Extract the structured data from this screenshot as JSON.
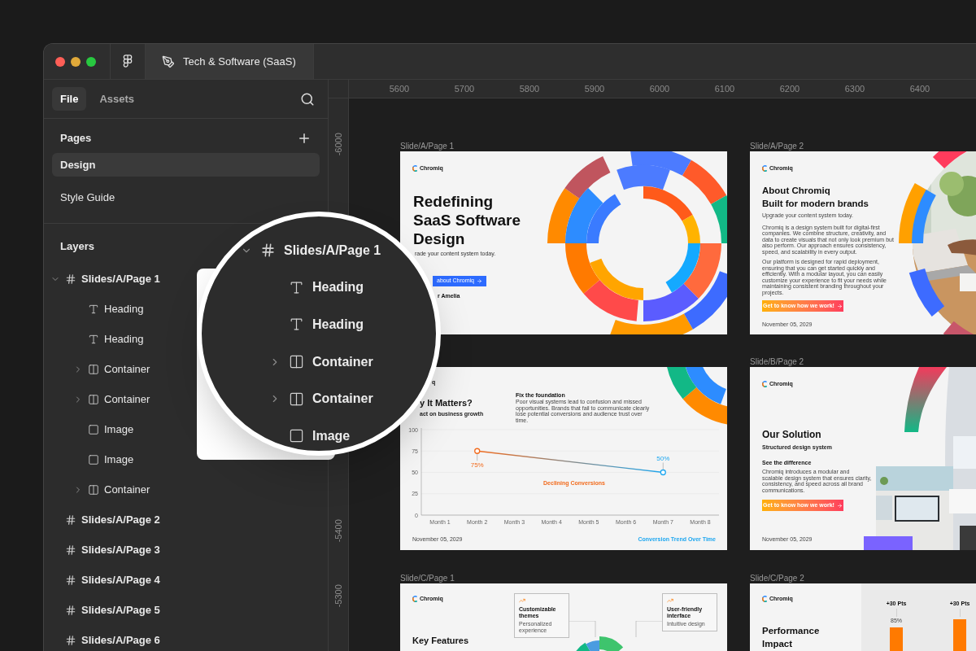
{
  "title_bar": {
    "tab_title": "Tech & Software (SaaS)"
  },
  "sidebar": {
    "tabs": [
      {
        "label": "File",
        "selected": true
      },
      {
        "label": "Assets",
        "selected": false
      }
    ],
    "pages_title": "Pages",
    "pages": [
      {
        "label": "Design",
        "selected": true
      },
      {
        "label": "Style Guide",
        "selected": false
      }
    ],
    "layers_title": "Layers",
    "layers": [
      {
        "kind": "frame",
        "label": "Slides/A/Page 1",
        "expanded": true,
        "children": [
          {
            "kind": "text",
            "label": "Heading"
          },
          {
            "kind": "text",
            "label": "Heading"
          },
          {
            "kind": "container",
            "label": "Container",
            "expanded": false
          },
          {
            "kind": "container",
            "label": "Container",
            "expanded": false
          },
          {
            "label": "Image"
          },
          {
            "label": "Image"
          },
          {
            "kind": "container",
            "label": "Container",
            "expanded": false
          }
        ]
      },
      {
        "kind": "frame",
        "label": "Slides/A/Page 2"
      },
      {
        "kind": "frame",
        "label": "Slides/A/Page 3"
      },
      {
        "kind": "frame",
        "label": "Slides/A/Page 4"
      },
      {
        "kind": "frame",
        "label": "Slides/A/Page 5"
      },
      {
        "kind": "frame",
        "label": "Slides/A/Page 6"
      }
    ]
  },
  "ruler": {
    "x_labels": [
      "5600",
      "5700",
      "5800",
      "5900",
      "6000",
      "6100",
      "6200",
      "6300",
      "6400"
    ],
    "y_labels": [
      "-6000",
      "-5400",
      "-5300"
    ]
  },
  "magnifier": {
    "layers": [
      {
        "kind": "frame",
        "label": "Slides/A/Page 1",
        "expanded": true
      },
      {
        "kind": "text",
        "label": "Heading"
      },
      {
        "kind": "text",
        "label": "Heading"
      },
      {
        "kind": "container",
        "label": "Container",
        "expanded": false
      },
      {
        "kind": "container",
        "label": "Container",
        "expanded": false
      },
      {
        "label": "Image"
      }
    ]
  },
  "slides": [
    {
      "kind": "hero",
      "label": "Slide/A/Page 1",
      "logo": "Chromiq",
      "heading": "Redefining SaaS Software Design",
      "subtitle": "rade your content system today.",
      "button": "about Chromiq",
      "author": "r Amelia"
    },
    {
      "kind": "about",
      "label": "Slide/A/Page 2",
      "logo": "Chromiq",
      "heading": "About Chromiq",
      "subheading": "Built for modern brands",
      "tagline": "Upgrade your content system today.",
      "paragraphs": [
        "Chromiq is a design system built for digital-first companies. We combine structure, creativity, and data to create visuals that not only look premium but also perform. Our approach ensures consistency, speed, and scalability in every output.",
        "Our platform is designed for rapid deployment, ensuring that you can get started quickly and efficiently. With a modular layout, you can easily customize your experience to fit your needs while maintaining consistent branding throughout your projects."
      ],
      "button": "Get to know how we work!",
      "date": "November 05, 2029"
    },
    {
      "kind": "chart",
      "logo": "q",
      "heading": "y It Matters?",
      "subtitle": "act on business growth",
      "note_title": "Fix the foundation",
      "note": "Poor visual systems lead to confusion and missed opportunities. Brands that fail to communicate clearly lose potential conversions and audience trust over time.",
      "date": "November 05, 2029",
      "chart_data": {
        "type": "line",
        "title": "Conversion Trend Over Time",
        "categories": [
          "Month 1",
          "Month 2",
          "Month 3",
          "Month 4",
          "Month 5",
          "Month 6",
          "Month 7",
          "Month 8"
        ],
        "series": [
          {
            "color": "#f26b1d",
            "marker": "circle",
            "values": [
              null,
              75,
              null,
              null,
              null,
              null,
              50,
              null
            ]
          }
        ],
        "ylim": [
          0,
          100
        ],
        "yticks": [
          0,
          25,
          50,
          75,
          100
        ],
        "grid": true,
        "annotations": [
          {
            "text": "75%",
            "x": "Month 2",
            "y": 75
          },
          {
            "text": "50%",
            "x": "Month 7",
            "y": 50
          },
          {
            "text": "Declining Conversions"
          }
        ]
      }
    },
    {
      "kind": "solution",
      "label": "Slide/B/Page 2",
      "logo": "Chromiq",
      "heading": "Our Solution",
      "subtitle": "Structured design system",
      "note_title": "See the difference",
      "note": "Chromiq introduces a modular and scalable design system that ensures clarity, consistency, and speed across all brand communications.",
      "button": "Get to know how we work!",
      "date": "November 05, 2029"
    },
    {
      "kind": "features",
      "label": "Slide/C/Page 1",
      "logo": "Chromiq",
      "heading": "Key Features",
      "cards": [
        {
          "title": "Customizable themes",
          "text": "Personalized experience"
        },
        {
          "title": "User-friendly interface",
          "text": "Intuitive design"
        }
      ]
    },
    {
      "kind": "performance",
      "label": "Slide/C/Page 2",
      "logo": "Chromiq",
      "heading": "Performance Impact",
      "bars": [
        {
          "delta": "+30 Pts",
          "value": "85%"
        },
        {
          "delta": "+30 Pts"
        }
      ]
    }
  ]
}
